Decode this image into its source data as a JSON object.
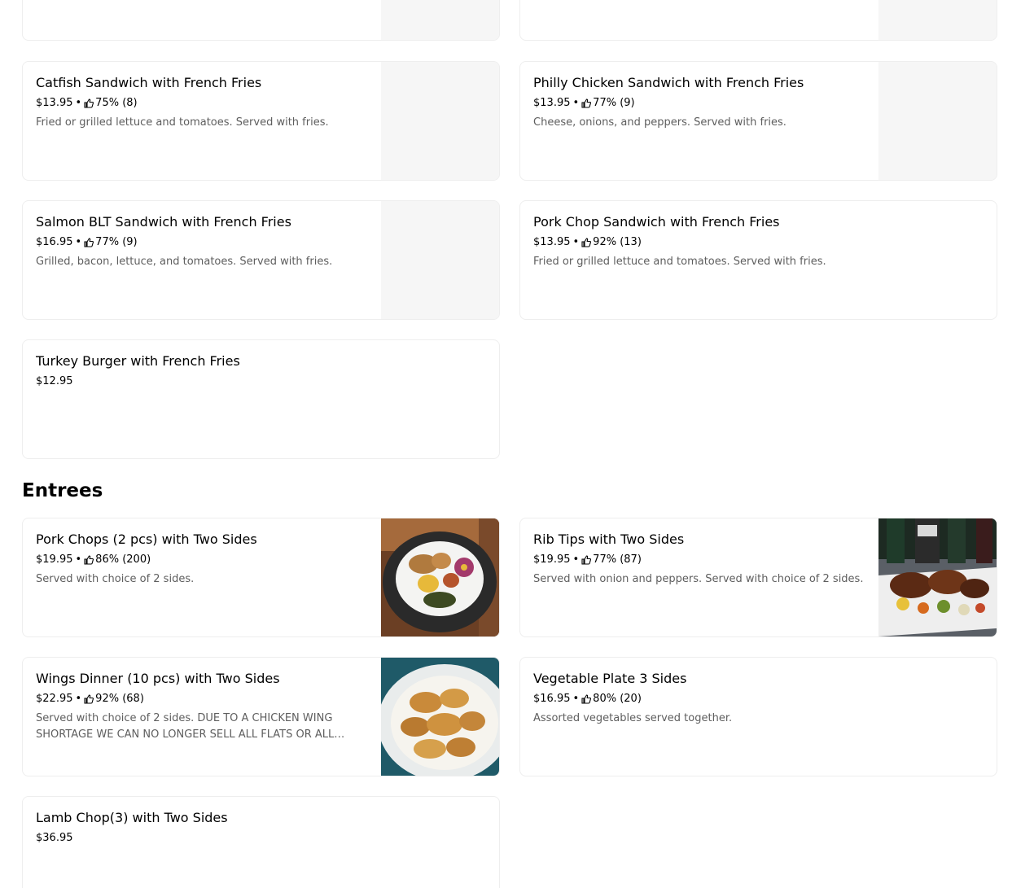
{
  "top_cards": [
    {
      "name": "Catfish Sandwich with French Fries",
      "price": "$13.95",
      "rating": "75% (8)",
      "description": "Fried or grilled lettuce and tomatoes. Served with fries."
    },
    {
      "name": "Philly Chicken Sandwich with French Fries",
      "price": "$13.95",
      "rating": "77% (9)",
      "description": "Cheese, onions, and peppers. Served with fries."
    },
    {
      "name": "Salmon BLT Sandwich with French Fries",
      "price": "$16.95",
      "rating": "77% (9)",
      "description": "Grilled, bacon, lettuce, and tomatoes. Served with fries."
    },
    {
      "name": "Pork Chop Sandwich with French Fries",
      "price": "$13.95",
      "rating": "92% (13)",
      "description": "Fried or grilled lettuce and tomatoes. Served with fries."
    },
    {
      "name": "Turkey Burger with French Fries",
      "price": "$12.95"
    }
  ],
  "entrees": {
    "title": "Entrees",
    "items": [
      {
        "name": "Pork Chops (2 pcs) with Two Sides",
        "price": "$19.95",
        "rating": "86% (200)",
        "description": "Served with choice of 2 sides."
      },
      {
        "name": "Rib Tips with Two Sides",
        "price": "$19.95",
        "rating": "77% (87)",
        "description": "Served with onion and peppers. Served with choice of 2 sides."
      },
      {
        "name": "Wings Dinner (10 pcs)  with Two Sides",
        "price": "$22.95",
        "rating": "92% (68)",
        "description": "Served with choice of 2 sides. DUE TO A CHICKEN WING SHORTAGE WE CAN NO LONGER SELL ALL FLATS OR ALL DRUMS."
      },
      {
        "name": "Vegetable Plate 3 Sides",
        "price": "$16.95",
        "rating": "80% (20)",
        "description": "Assorted vegetables served together."
      },
      {
        "name": "Lamb Chop(3) with Two Sides",
        "price": "$36.95"
      }
    ]
  },
  "separator": "•",
  "icons": {
    "rating": "thumbs-up-icon"
  },
  "colors": {
    "border": "#eeeeee",
    "description": "#5e5e5e",
    "image_placeholder": "#f6f6f6"
  }
}
